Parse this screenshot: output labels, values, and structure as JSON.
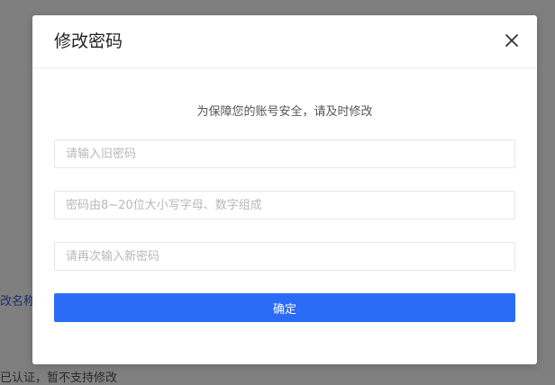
{
  "background": {
    "text_left": "改名称",
    "text_bottom": "已认证，暂不支持修改"
  },
  "modal": {
    "title": "修改密码",
    "close_icon": "close-icon",
    "subtitle": "为保障您的账号安全，请及时修改",
    "old_password_placeholder": "请输入旧密码",
    "new_password_placeholder": "密码由8~20位大小写字母、数字组成",
    "confirm_password_placeholder": "请再次输入新密码",
    "confirm_label": "确定"
  },
  "colors": {
    "accent": "#2a6cf5",
    "overlay": "#7f7f7f"
  }
}
